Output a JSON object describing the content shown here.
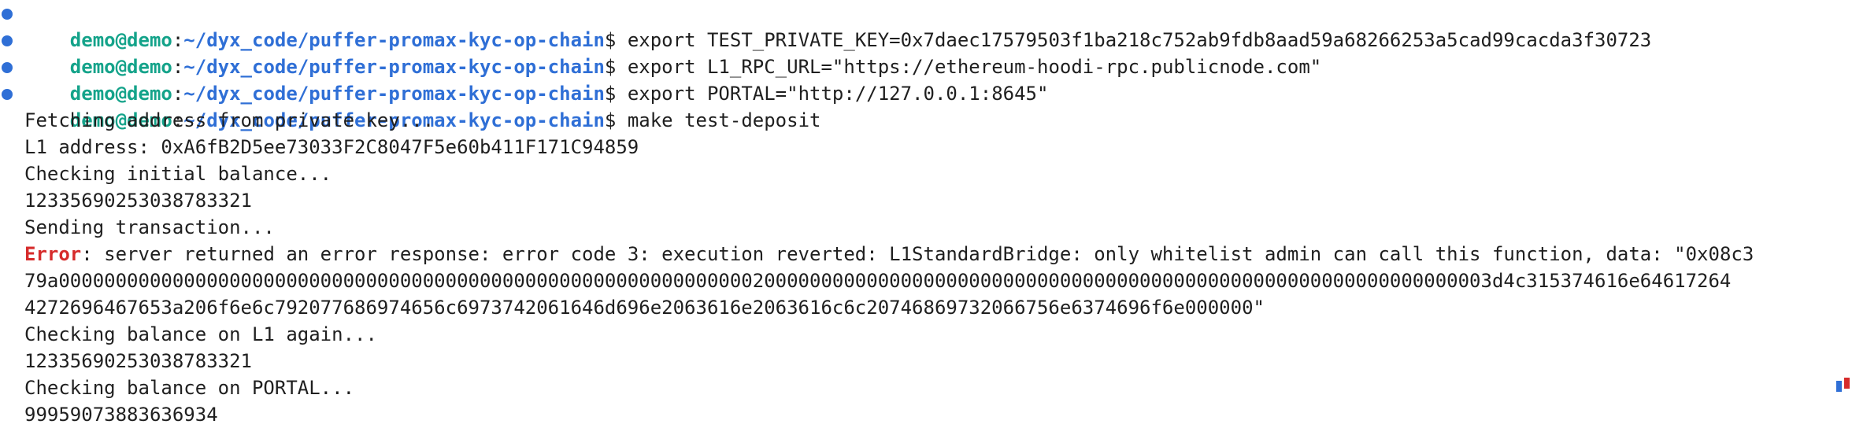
{
  "prompt": {
    "user_host": "demo@demo",
    "separator": ":",
    "path": "~/dyx_code/puffer-promax-kyc-op-chain",
    "symbol": "$ "
  },
  "commands": [
    "export TEST_PRIVATE_KEY=0x7daec17579503f1ba218c752ab9fdb8aad59a68266253a5cad99cacda3f30723",
    "export L1_RPC_URL=\"https://ethereum-hoodi-rpc.publicnode.com\"",
    "export PORTAL=\"http://127.0.0.1:8645\"",
    "make test-deposit"
  ],
  "output": {
    "fetching": "Fetching address from private key...",
    "l1_address": "L1 address: 0xA6fB2D5ee73033F2C8047F5e60b411F171C94859",
    "checking_initial": "Checking initial balance...",
    "initial_balance": "12335690253038783321",
    "sending": "Sending transaction...",
    "error_label": "Error",
    "error_text_1": ": server returned an error response: error code 3: execution reverted: L1StandardBridge: only whitelist admin can call this function, data: \"0x08c3",
    "error_text_2": "79a000000000000000000000000000000000000000000000000000000000000020000000000000000000000000000000000000000000000000000000000000003d4c315374616e64617264",
    "error_text_3": "4272696467653a206f6e6c792077686974656c6973742061646d696e2063616e2063616c6c20746869732066756e6374696f6e000000\"",
    "checking_l1_again": "Checking balance on L1 again...",
    "l1_balance_again": "12335690253038783321",
    "checking_portal": "Checking balance on PORTAL...",
    "portal_balance": "99959073883636934"
  },
  "colors": {
    "prompt_dot": "#2f6fd6",
    "user_host": "#14a38a",
    "path": "#2f6fd6",
    "error": "#d62b2b",
    "marker_blue": "#2f6fd6",
    "marker_red": "#d62b2b"
  }
}
